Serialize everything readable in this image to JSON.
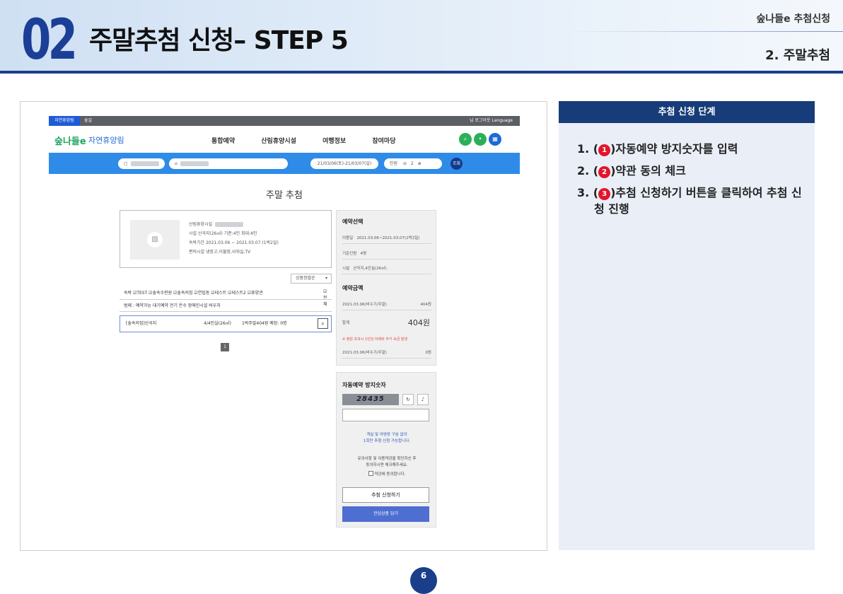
{
  "header": {
    "number": "02",
    "title": "주말추첨 신청– STEP 5",
    "corner_top": "숲나들e 추첨신청",
    "corner_bottom": "2. 주말추첨"
  },
  "screenshot": {
    "gnb": {
      "tab_active": "자연휴양림",
      "tab_other": "숲길",
      "right": "님  로그아웃  Language"
    },
    "logo": "숲나들e",
    "logo_sub": "자연휴양림",
    "menu": [
      "통합예약",
      "산림휴양시설",
      "여행정보",
      "참여마당"
    ],
    "search_bar": {
      "date_range": "21/03/06(토)-21/03/07(일)",
      "people_label": "인원",
      "people_count": "2",
      "search_button": "조회"
    },
    "page_title": "주말 추첨",
    "facility_info": {
      "lines": [
        "산림휴양시설",
        "시설  산곡지(26㎡) 기준:4인 최대:4인",
        "숙박기간  2021.03.06 ~ 2021.03.07 (1박2일)",
        "편의시설  냉장고,이불장,샤워실,TV"
      ]
    },
    "sort_select": "상품정렬순",
    "filters": {
      "items": "숙박  ☑TEST ☑숲속수련원 ☑숲속의집 ☑연립동 ☑테스트 ☑테스트2 ☑휴양관",
      "all": "☑전체"
    },
    "legend": "범례 :  예약가능  대기예약  전기  온수  장애인시설  바우처",
    "result_row": {
      "name": "[숲속의집]산곡지",
      "size": "4/4인실(26㎡)",
      "price": "1박주말404원  예정: 0명"
    },
    "pagination": "1",
    "reservation_panel": {
      "title": "예약선택",
      "use_date_label": "이용일",
      "use_date": "2021.03.06~2021.03.07(1박2일)",
      "base_people_label": "기준인원",
      "base_people": "4명",
      "facility_label": "시설",
      "facility": "산곡지,4인실(26㎡)",
      "amount_title": "예약금액",
      "line1_label": "2021.03.06(비수기/주말)",
      "line1_value": "404원",
      "total_label": "합계",
      "total_value": "404원",
      "warning": "※ 정원 초과시 1인당 아래와 추가 요금 발생",
      "line2_label": "2021.03.06(비수기/주말)",
      "line2_value": "0원"
    },
    "captcha_panel": {
      "title": "자동예약 방지숫자",
      "captcha": "28435",
      "note1": "객실 및 야영장 구분 없이\n1회만 추첨 신청 가능합니다.",
      "note2": "유의사항 및 이용약관을 확인하신 후\n동의하시면 체크해주세요.",
      "agree": "약관에 동의합니다.",
      "apply_button": "추첨 신청하기",
      "fav_button": "관심상품 담기"
    }
  },
  "side": {
    "heading": "추첨 신청 단계",
    "steps": [
      {
        "prefix": "1. (",
        "badge": "1",
        "text": ")자동예약 방지숫자를 입력"
      },
      {
        "prefix": "2. (",
        "badge": "2",
        "text": ")약관 동의 체크"
      },
      {
        "prefix": "3. (",
        "badge": "3",
        "text": ")추첨 신청하기 버튼을 클릭하여 추첨 신청 진행"
      }
    ]
  },
  "page_number": "6"
}
